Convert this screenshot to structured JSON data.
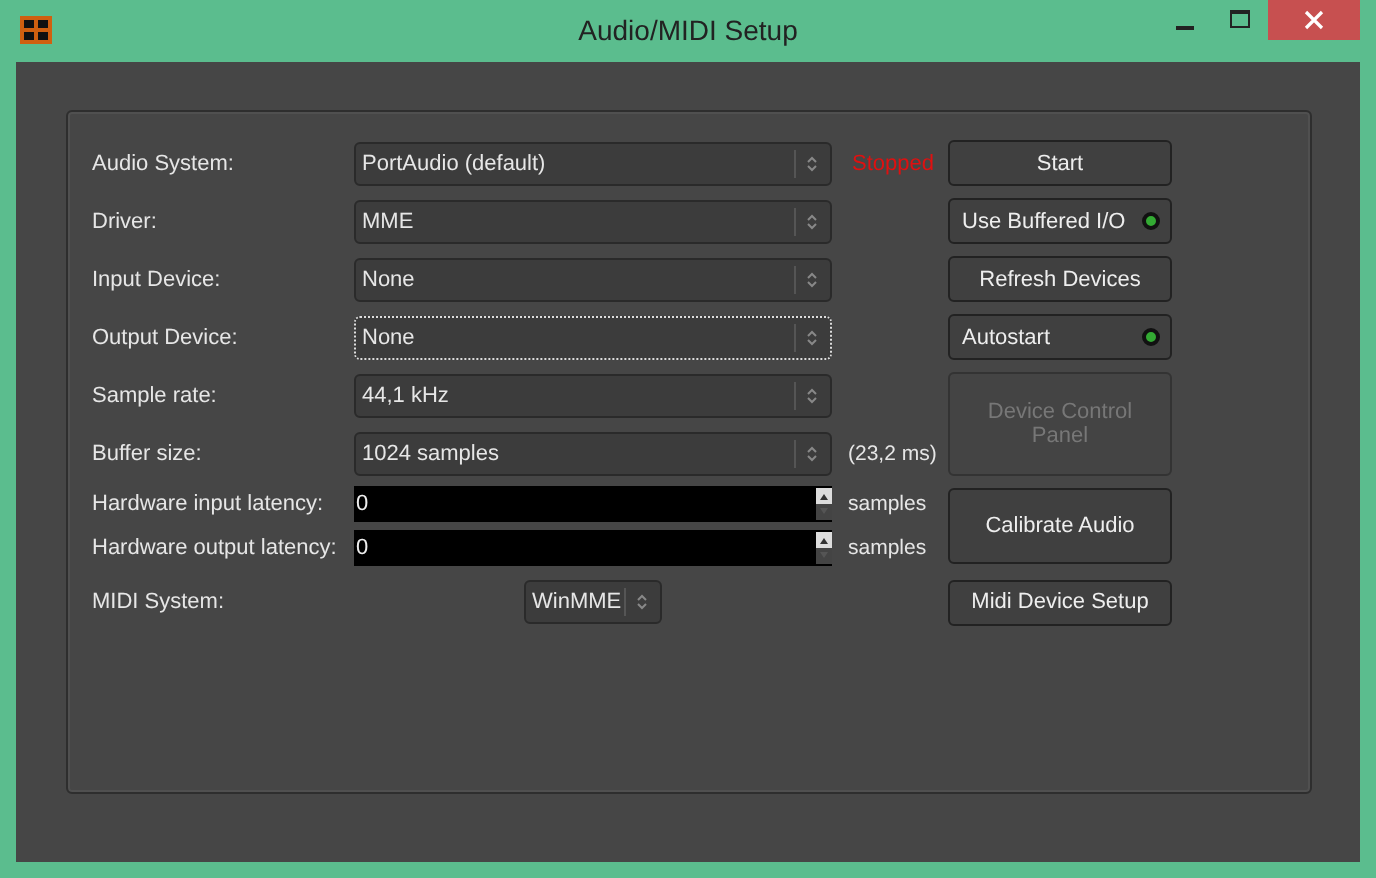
{
  "window": {
    "title": "Audio/MIDI Setup"
  },
  "status": {
    "text": "Stopped"
  },
  "rows": [
    {
      "label": "Audio System:",
      "kind": "combo",
      "value": "PortAudio (default)",
      "focused": false
    },
    {
      "label": "Driver:",
      "kind": "combo",
      "value": "MME",
      "focused": false
    },
    {
      "label": "Input Device:",
      "kind": "combo",
      "value": "None",
      "focused": false
    },
    {
      "label": "Output Device:",
      "kind": "combo",
      "value": "None",
      "focused": true
    },
    {
      "label": "Sample rate:",
      "kind": "combo",
      "value": "44,1 kHz",
      "focused": false
    },
    {
      "label": "Buffer size:",
      "kind": "combo",
      "value": "1024 samples",
      "focused": false,
      "suffix": "(23,2 ms)"
    },
    {
      "label": "Hardware input latency:",
      "kind": "spin",
      "value": "0",
      "suffix": "samples"
    },
    {
      "label": "Hardware output latency:",
      "kind": "spin",
      "value": "0",
      "suffix": "samples"
    },
    {
      "label": "MIDI System:",
      "kind": "small-combo",
      "value": "WinMME"
    }
  ],
  "buttons": [
    {
      "label": "Start",
      "kind": "button",
      "disabled": false
    },
    {
      "label": "Use Buffered I/O",
      "kind": "toggle",
      "disabled": false,
      "on": true
    },
    {
      "label": "Refresh Devices",
      "kind": "button",
      "disabled": false
    },
    {
      "label": "Autostart",
      "kind": "toggle",
      "disabled": false,
      "on": true
    },
    {
      "label": "Device Control Panel",
      "kind": "button",
      "disabled": true
    },
    {
      "label": "Calibrate Audio",
      "kind": "button",
      "disabled": false
    },
    {
      "label": "Midi Device Setup",
      "kind": "button",
      "disabled": false
    }
  ]
}
